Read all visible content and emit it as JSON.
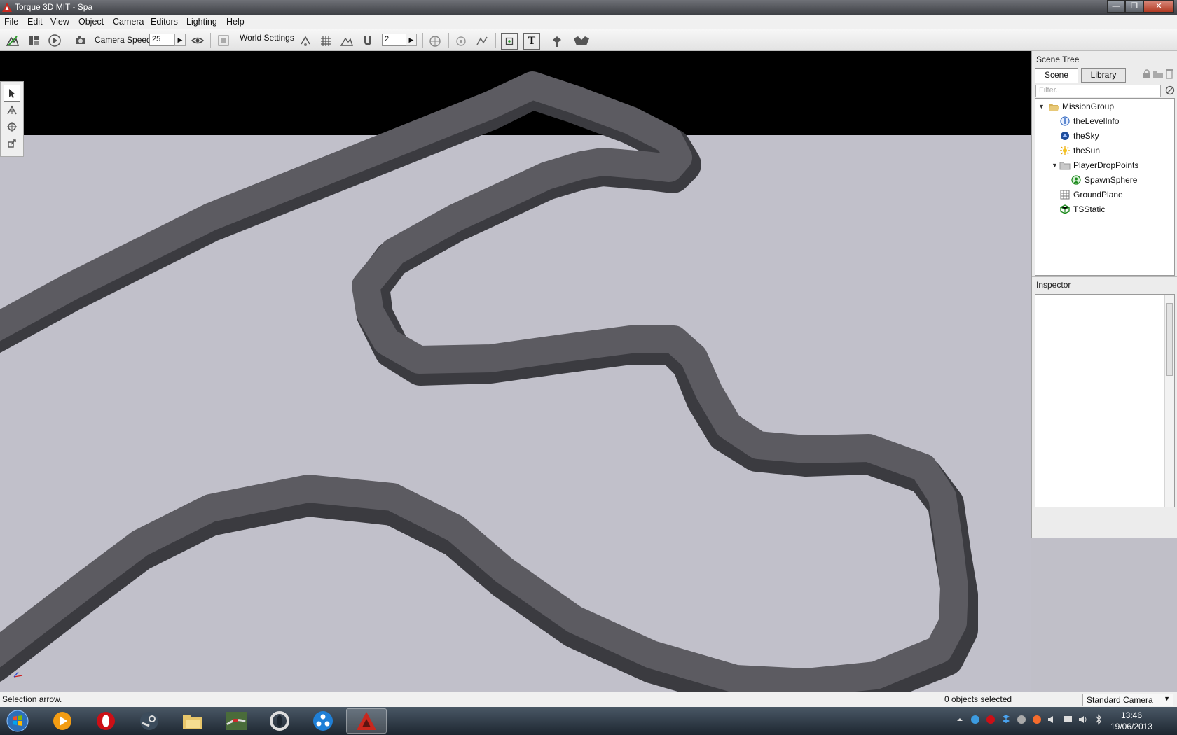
{
  "window": {
    "title": "Torque 3D MIT - Spa"
  },
  "menu": [
    "File",
    "Edit",
    "View",
    "Object",
    "Camera",
    "Editors",
    "Lighting",
    "Help"
  ],
  "toolbar": {
    "camera_speed_label": "Camera Speed",
    "camera_speed_value": "25",
    "world_settings_label": "World Settings",
    "snap_value": "2"
  },
  "scene_tree": {
    "title": "Scene Tree",
    "tabs": [
      "Scene",
      "Library"
    ],
    "filter_placeholder": "Filter...",
    "nodes": [
      {
        "label": "MissionGroup",
        "icon": "folder-open-icon"
      },
      {
        "label": "theLevelInfo",
        "icon": "info-icon"
      },
      {
        "label": "theSky",
        "icon": "sky-icon"
      },
      {
        "label": "theSun",
        "icon": "sun-icon"
      },
      {
        "label": "PlayerDropPoints",
        "icon": "folder-icon"
      },
      {
        "label": "SpawnSphere",
        "icon": "spawn-sphere-icon"
      },
      {
        "label": "GroundPlane",
        "icon": "grid-icon"
      },
      {
        "label": "TSStatic",
        "icon": "static-mesh-icon"
      }
    ]
  },
  "inspector": {
    "title": "Inspector"
  },
  "status": {
    "hint": "Selection arrow.",
    "selection": "0 objects selected",
    "camera_mode": "Standard Camera"
  },
  "taskbar": {
    "time": "13:46",
    "date": "19/06/2013",
    "apps": [
      "start-orb-icon",
      "media-player-icon",
      "opera-icon",
      "steam-icon",
      "file-explorer-icon",
      "racing-game-icon",
      "opera-next-icon",
      "community-app-icon",
      "torque-3d-icon"
    ]
  }
}
